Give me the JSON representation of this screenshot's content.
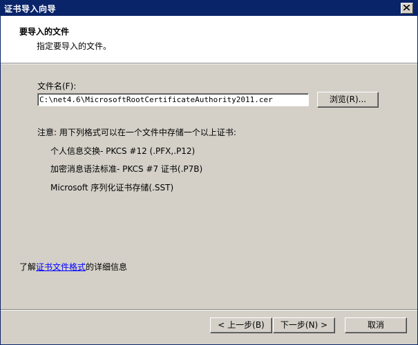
{
  "window": {
    "title": "证书导入向导",
    "close_icon": "close-icon"
  },
  "header": {
    "title": "要导入的文件",
    "subtitle": "指定要导入的文件。"
  },
  "file": {
    "label": "文件名(F):",
    "value": "C:\\net4.6\\MicrosoftRootCertificateAuthority2011.cer",
    "browse_label": "浏览(R)..."
  },
  "formats": {
    "note": "注意: 用下列格式可以在一个文件中存储一个以上证书:",
    "items": [
      "个人信息交换- PKCS #12 (.PFX,.P12)",
      "加密消息语法标准- PKCS #7 证书(.P7B)",
      "Microsoft 序列化证书存储(.SST)"
    ]
  },
  "learn_more": {
    "prefix": "了解",
    "link": "证书文件格式",
    "suffix": "的详细信息"
  },
  "buttons": {
    "back": "< 上一步(B)",
    "next": "下一步(N) >",
    "cancel": "取消"
  },
  "colors": {
    "titlebar": "#0a246a",
    "dialog_bg": "#d4d0c8",
    "header_bg": "#ffffff",
    "link": "#0000ff"
  }
}
